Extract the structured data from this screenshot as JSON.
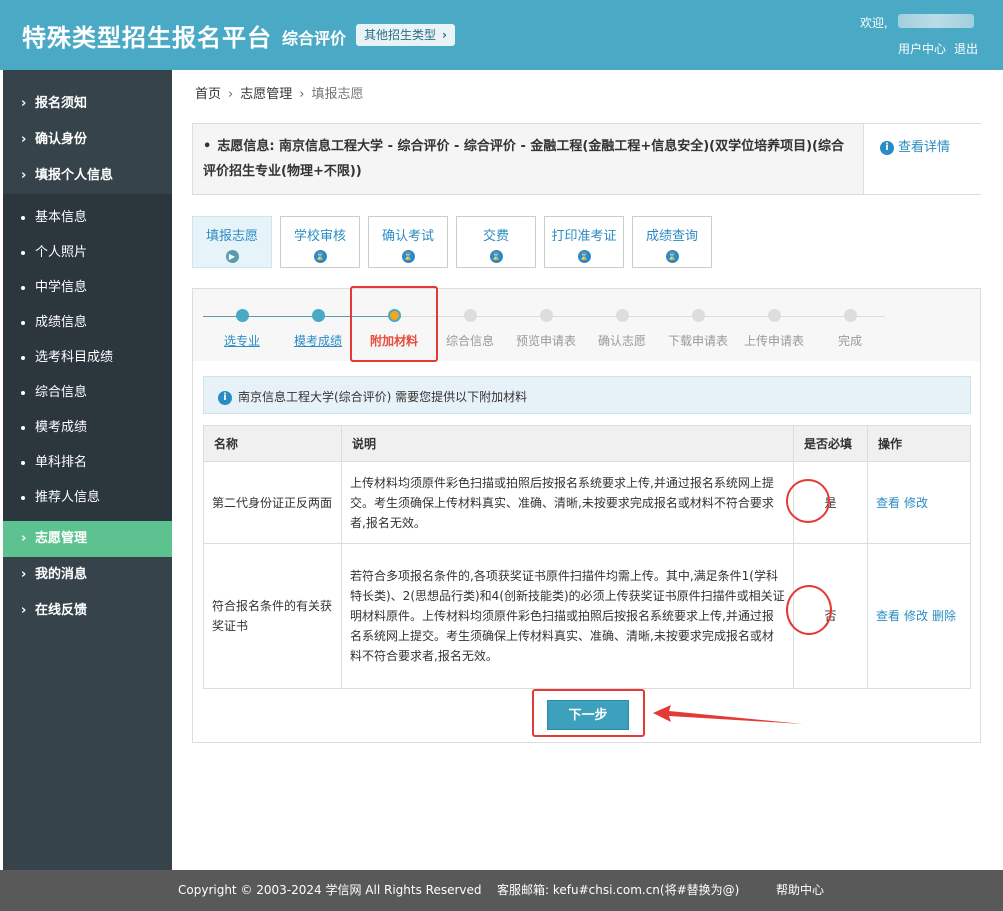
{
  "header": {
    "brand": "特殊类型招生报名平台",
    "subtitle": "综合评价",
    "other_types_btn": "其他招生类型",
    "welcome": "欢迎,",
    "user_center": "用户中心",
    "logout": "退出"
  },
  "sidebar": {
    "groups_top": [
      {
        "label": "报名须知"
      },
      {
        "label": "确认身份"
      },
      {
        "label": "填报个人信息"
      }
    ],
    "sub_items": [
      {
        "label": "基本信息"
      },
      {
        "label": "个人照片"
      },
      {
        "label": "中学信息"
      },
      {
        "label": "成绩信息"
      },
      {
        "label": "选考科目成绩"
      },
      {
        "label": "综合信息"
      },
      {
        "label": "模考成绩"
      },
      {
        "label": "单科排名"
      },
      {
        "label": "推荐人信息"
      }
    ],
    "groups_bottom": [
      {
        "label": "志愿管理"
      },
      {
        "label": "我的消息"
      },
      {
        "label": "在线反馈"
      }
    ]
  },
  "breadcrumb": {
    "home": "首页",
    "section": "志愿管理",
    "current": "填报志愿"
  },
  "info": {
    "text": "志愿信息: 南京信息工程大学 - 综合评价 - 综合评价 - 金融工程(金融工程+信息安全)(双学位培养项目)(综合评价招生专业(物理+不限))",
    "detail_link": "查看详情"
  },
  "tabs": [
    {
      "label": "填报志愿"
    },
    {
      "label": "学校审核"
    },
    {
      "label": "确认考试"
    },
    {
      "label": "交费"
    },
    {
      "label": "打印准考证"
    },
    {
      "label": "成绩查询"
    }
  ],
  "steps": [
    {
      "label": "选专业",
      "state": "done"
    },
    {
      "label": "模考成绩",
      "state": "done"
    },
    {
      "label": "附加材料",
      "state": "current"
    },
    {
      "label": "综合信息",
      "state": "todo"
    },
    {
      "label": "预览申请表",
      "state": "todo"
    },
    {
      "label": "确认志愿",
      "state": "todo"
    },
    {
      "label": "下载申请表",
      "state": "todo"
    },
    {
      "label": "上传申请表",
      "state": "todo"
    },
    {
      "label": "完成",
      "state": "todo"
    }
  ],
  "notice": "南京信息工程大学(综合评价) 需要您提供以下附加材料",
  "table": {
    "headers": [
      "名称",
      "说明",
      "是否必填",
      "操作"
    ],
    "rows": [
      {
        "name": "第二代身份证正反两面",
        "desc": "上传材料均须原件彩色扫描或拍照后按报名系统要求上传,并通过报名系统网上提交。考生须确保上传材料真实、准确、清晰,未按要求完成报名或材料不符合要求者,报名无效。",
        "required": "是",
        "ops": [
          "查看",
          "修改"
        ]
      },
      {
        "name": "符合报名条件的有关获奖证书",
        "desc": "若符合多项报名条件的,各项获奖证书原件扫描件均需上传。其中,满足条件1(学科特长类)、2(思想品行类)和4(创新技能类)的必须上传获奖证书原件扫描件或相关证明材料原件。上传材料均须原件彩色扫描或拍照后按报名系统要求上传,并通过报名系统网上提交。考生须确保上传材料真实、准确、清晰,未按要求完成报名或材料不符合要求者,报名无效。",
        "required": "否",
        "ops": [
          "查看",
          "修改",
          "删除"
        ]
      }
    ]
  },
  "next_btn": "下一步",
  "footer": {
    "copyright": "Copyright © 2003-2024 学信网 All Rights Reserved",
    "email": "客服邮箱: kefu#chsi.com.cn(将#替换为@)",
    "help": "帮助中心"
  },
  "colors": {
    "header": "#4aa9c4",
    "sidebar": "#36434b",
    "active": "#5cc28f",
    "link": "#2b8cc4",
    "annotation": "#e53935"
  }
}
